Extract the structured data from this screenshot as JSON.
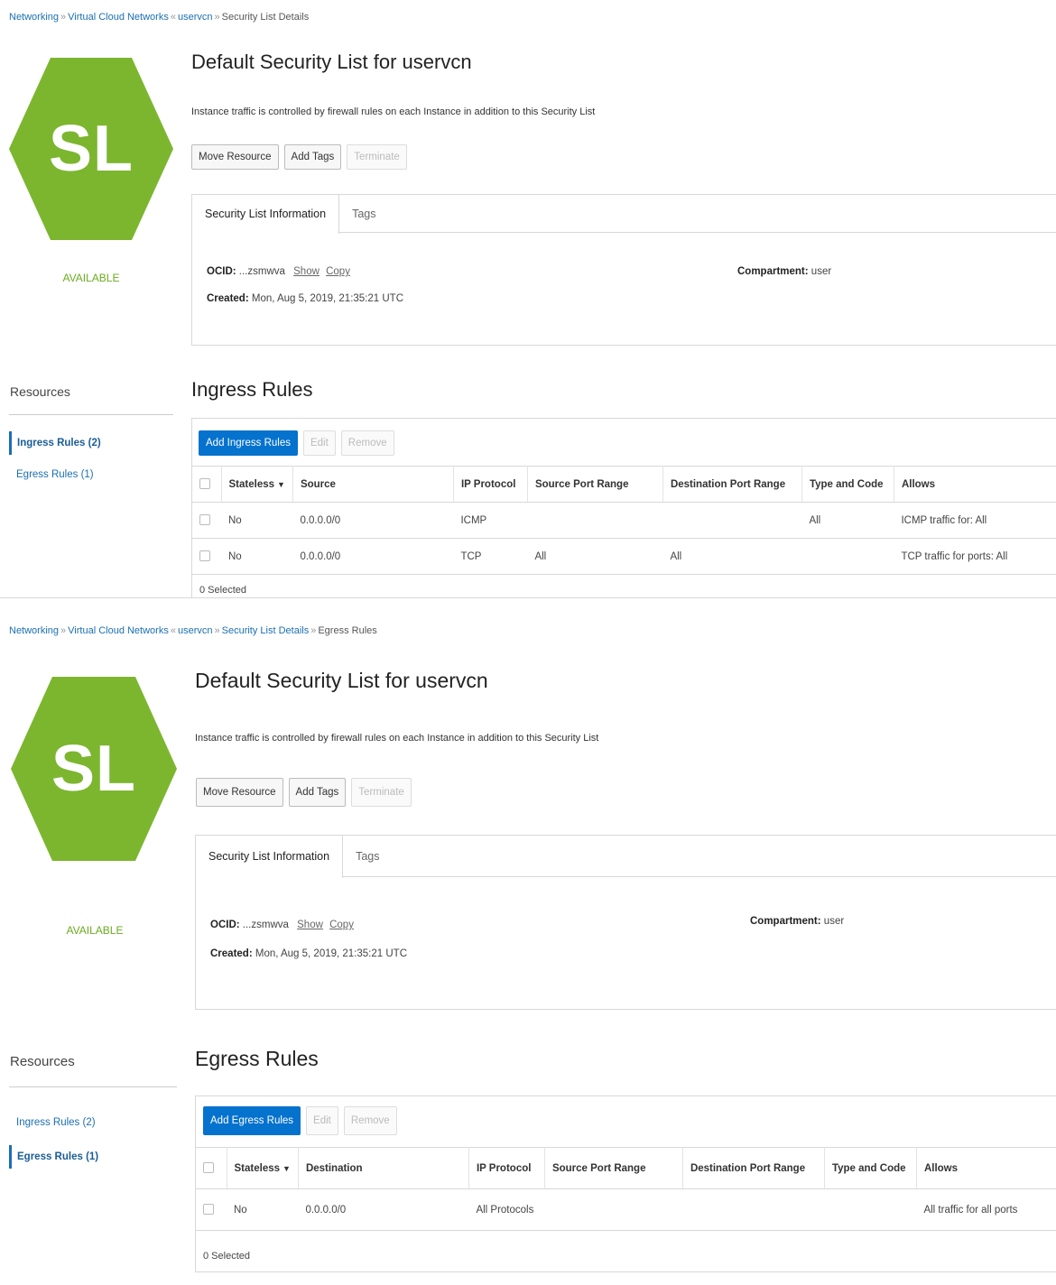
{
  "colors": {
    "accent": "#0572ce",
    "hexagon": "#7cb62f",
    "status_green": "#6bab22",
    "link": "#1a6fb3"
  },
  "common": {
    "hex_label": "SL",
    "status": "AVAILABLE",
    "title": "Default Security List for uservcn",
    "description": "Instance traffic is controlled by firewall rules on each Instance in addition to this Security List",
    "buttons": {
      "move": "Move Resource",
      "add_tags": "Add Tags",
      "terminate": "Terminate"
    },
    "tabs": {
      "info": "Security List Information",
      "tags": "Tags"
    },
    "ocid_label": "OCID:",
    "ocid_value": "...zsmwva",
    "show": "Show",
    "copy": "Copy",
    "created_label": "Created:",
    "created_value": "Mon, Aug 5, 2019, 21:35:21 UTC",
    "compartment_label": "Compartment:",
    "compartment_value": "user",
    "resources": "Resources",
    "ingress_item": "Ingress Rules (2)",
    "egress_item": "Egress Rules (1)",
    "edit": "Edit",
    "remove": "Remove",
    "selected": "0 Selected"
  },
  "panel1": {
    "breadcrumb": [
      "Networking",
      "Virtual Cloud Networks",
      "uservcn",
      "Security List Details"
    ],
    "section_title": "Ingress Rules",
    "add_button": "Add Ingress Rules",
    "columns": [
      "Stateless",
      "Source",
      "IP Protocol",
      "Source Port Range",
      "Destination Port Range",
      "Type and Code",
      "Allows"
    ],
    "rows": [
      [
        "No",
        "0.0.0.0/0",
        "ICMP",
        "",
        "",
        "All",
        "ICMP traffic for: All"
      ],
      [
        "No",
        "0.0.0.0/0",
        "TCP",
        "All",
        "All",
        "",
        "TCP traffic for ports: All"
      ]
    ]
  },
  "panel2": {
    "breadcrumb": [
      "Networking",
      "Virtual Cloud Networks",
      "uservcn",
      "Security List Details",
      "Egress Rules"
    ],
    "section_title": "Egress Rules",
    "add_button": "Add Egress Rules",
    "columns": [
      "Stateless",
      "Destination",
      "IP Protocol",
      "Source Port Range",
      "Destination Port Range",
      "Type and Code",
      "Allows"
    ],
    "rows": [
      [
        "No",
        "0.0.0.0/0",
        "All Protocols",
        "",
        "",
        "",
        "All traffic for all ports"
      ]
    ]
  }
}
